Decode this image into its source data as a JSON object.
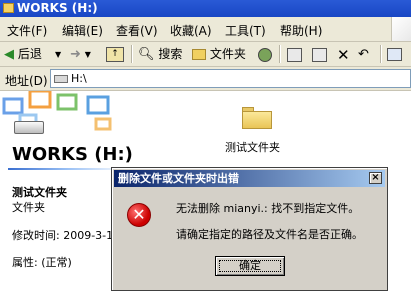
{
  "window": {
    "title": "WORKS (H:)"
  },
  "menu": {
    "items": [
      "文件(F)",
      "编辑(E)",
      "查看(V)",
      "收藏(A)",
      "工具(T)",
      "帮助(H)"
    ]
  },
  "toolbar": {
    "back_label": "后退",
    "search_label": "搜索",
    "folders_label": "文件夹"
  },
  "address": {
    "label": "地址(D)",
    "value": "H:\\"
  },
  "panel": {
    "drive_title": "WORKS (H:)",
    "item_name": "测试文件夹",
    "item_type": "文件夹",
    "modified": "修改时间: 2009-3-1",
    "attributes": "属性: (正常)"
  },
  "folder": {
    "label": "测试文件夹"
  },
  "dialog": {
    "title": "删除文件或文件夹时出错",
    "close": "×",
    "message_line1": "无法删除 mianyi.: 找不到指定文件。",
    "message_line2": "请确定指定的路径及文件名是否正确。",
    "ok_label": "确定"
  }
}
